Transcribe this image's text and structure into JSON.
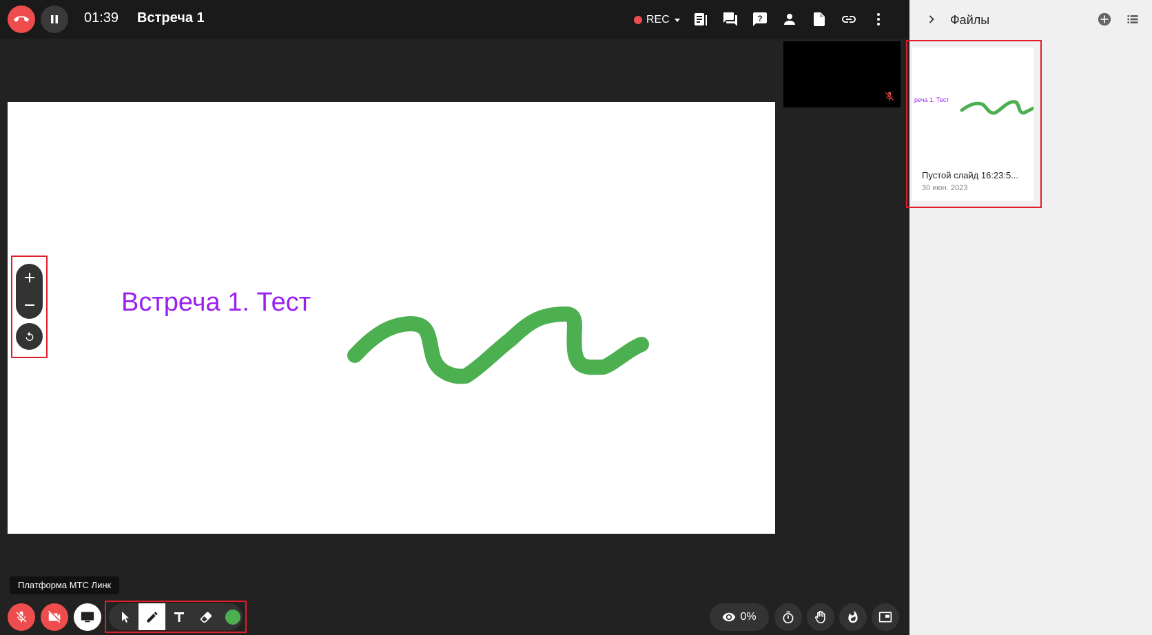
{
  "header": {
    "timer": "01:39",
    "title": "Встреча 1",
    "rec_label": "REC"
  },
  "board": {
    "text": "Встреча 1. Тест",
    "text_color": "#9a1ff0",
    "stroke_color": "#4caf50"
  },
  "files_panel": {
    "title": "Файлы",
    "files": [
      {
        "thumb_text": "реча 1. Тест",
        "name": "Пустой слайд 16:23:5...",
        "date": "30 июн. 2023"
      }
    ]
  },
  "tooltip": "Платформа МТС Линк",
  "bottom": {
    "viewers_percent": "0%",
    "active_color": "#4caf50"
  },
  "colors": {
    "danger": "#ef4d4d",
    "accent_outline": "#e01e2a"
  }
}
